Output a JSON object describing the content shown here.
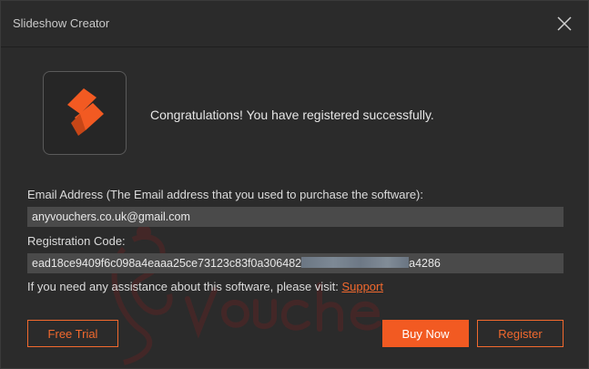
{
  "window": {
    "title": "Slideshow Creator"
  },
  "message": {
    "congrats": "Congratulations! You have registered successfully."
  },
  "email": {
    "label": "Email Address (The Email address that you used to purchase the software):",
    "value": "anyvouchers.co.uk@gmail.com"
  },
  "registration": {
    "label": "Registration Code:",
    "code_prefix": "ead18ce9409f6c098a4eaaa25ce73123c83f0a306482",
    "code_suffix": "a4286"
  },
  "help": {
    "text": "If you need any assistance about this software, please visit:",
    "link": "Support"
  },
  "buttons": {
    "free_trial": "Free Trial",
    "buy_now": "Buy Now",
    "register": "Register"
  },
  "colors": {
    "accent": "#f2692e",
    "background": "#2b2b2b",
    "field": "#4a4a4a"
  },
  "icons": {
    "close": "close-icon",
    "logo": "app-logo-icon"
  }
}
